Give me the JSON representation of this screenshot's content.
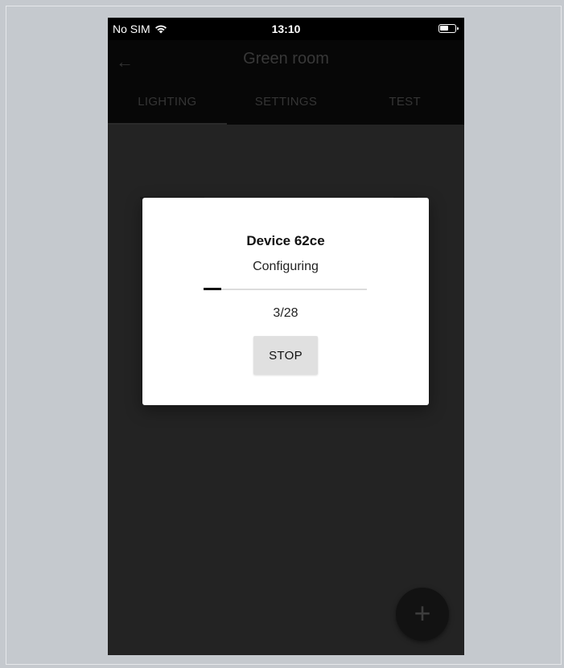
{
  "status_bar": {
    "carrier": "No SIM",
    "time": "13:10"
  },
  "app_bar": {
    "title": "Green room"
  },
  "tabs": [
    {
      "label": "LIGHTING"
    },
    {
      "label": "SETTINGS"
    },
    {
      "label": "TEST"
    }
  ],
  "dialog": {
    "title": "Device 62ce",
    "status": "Configuring",
    "progress_current": 3,
    "progress_total": 28,
    "count_text": "3/28",
    "stop_label": "STOP"
  },
  "fab": {
    "icon": "plus-icon",
    "glyph": "+"
  },
  "colors": {
    "overlay": "#2b2b2b",
    "dialog_bg": "#ffffff",
    "button_bg": "#e0e0e0"
  }
}
